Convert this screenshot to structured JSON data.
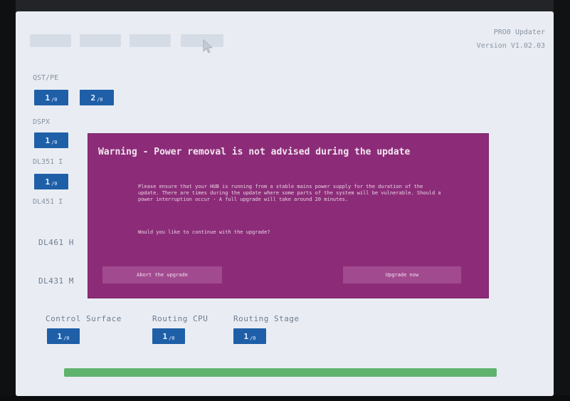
{
  "header": {
    "app_title": "PRO0 Updater",
    "version": "Version V1.02.03"
  },
  "sections": {
    "qsf": {
      "label": "QST/PE",
      "buttons": [
        "1",
        "2"
      ]
    },
    "dsp": {
      "label": "DSPX",
      "buttons": [
        "1"
      ]
    },
    "dl351a": {
      "label": "DL351 I",
      "buttons": [
        "1"
      ]
    },
    "dl451": {
      "label": "DL451 I"
    },
    "dl461": {
      "label": "DL461 H"
    },
    "dl431": {
      "label": "DL431 M"
    },
    "bottom": [
      {
        "label": "Control Surface",
        "button": "1"
      },
      {
        "label": "Routing CPU",
        "button": "1"
      },
      {
        "label": "Routing Stage",
        "button": "1"
      }
    ]
  },
  "dialog": {
    "title": "Warning - Power removal is not advised during the update",
    "body": "Please ensure that your HUB is running from a stable mains power supply for the duration of the update. There are times during the update where some parts of the system will be vulnerable. Should a power interruption occur - A full upgrade will take around 20 minutes.",
    "question": "Would you like to continue with the upgrade?",
    "abort_label": "Abort the upgrade",
    "upgrade_label": "Upgrade now"
  },
  "progress": {
    "fraction": 1.0
  },
  "colors": {
    "dialog_bg": "#8c2c78",
    "button_blue": "#1f5fa8",
    "progress_green": "#5fb36d"
  }
}
